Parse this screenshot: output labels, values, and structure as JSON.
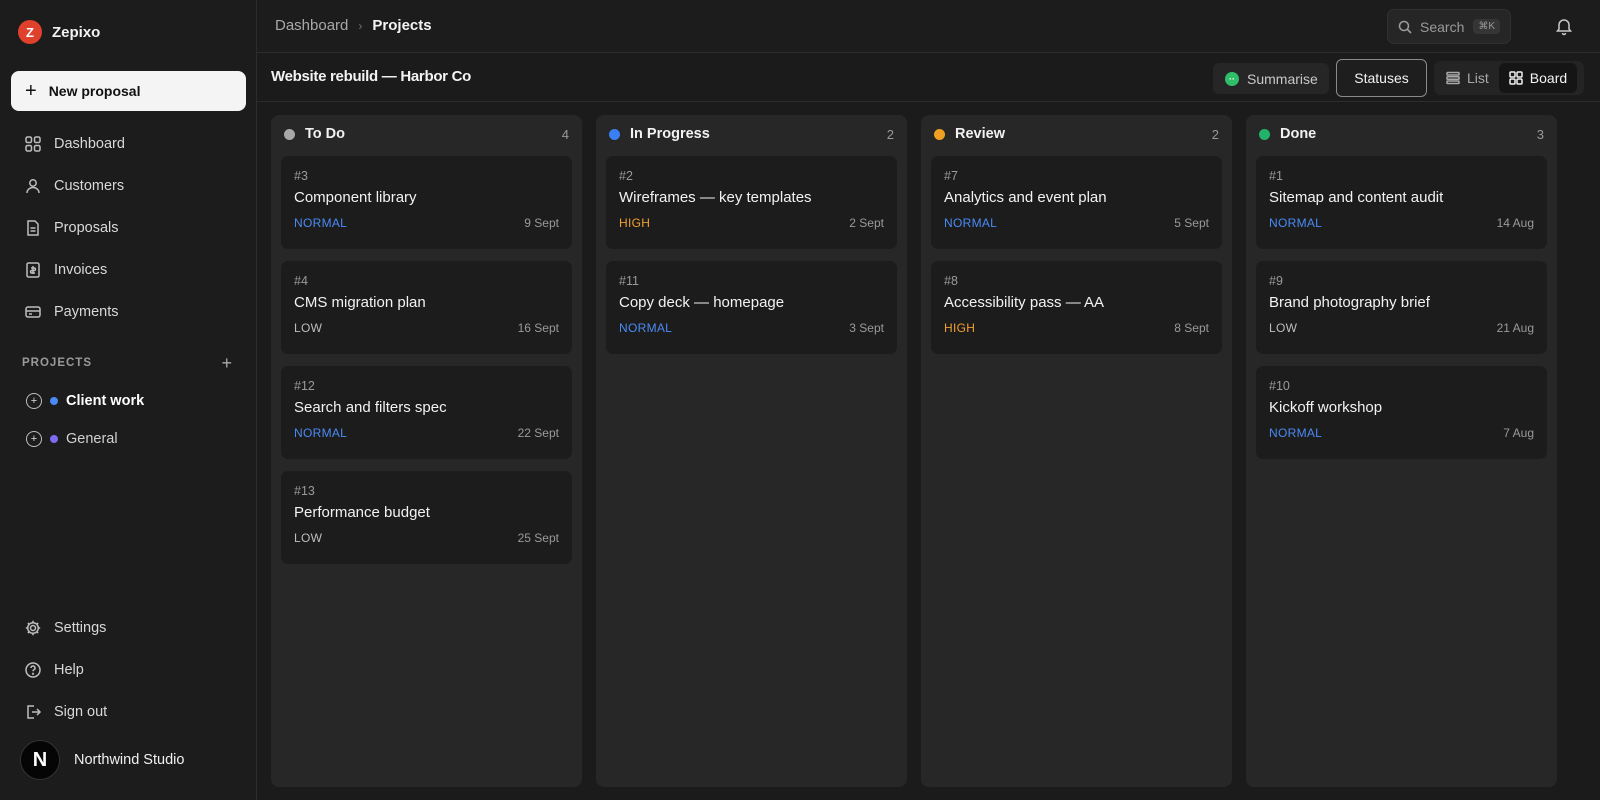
{
  "brand": {
    "name": "Zepixo",
    "logo_letter": "Z",
    "color": "#e0412c"
  },
  "sidebar": {
    "new_button": "New proposal",
    "nav": [
      {
        "label": "Dashboard",
        "icon": "grid-icon"
      },
      {
        "label": "Customers",
        "icon": "users-icon"
      },
      {
        "label": "Proposals",
        "icon": "file-icon"
      },
      {
        "label": "Invoices",
        "icon": "invoice-icon"
      },
      {
        "label": "Payments",
        "icon": "card-icon"
      }
    ],
    "projects_label": "PROJECTS",
    "projects": [
      {
        "name": "Client work",
        "color": "#4a8af4"
      },
      {
        "name": "General",
        "color": "#7b6cf0"
      }
    ],
    "bottom_nav": [
      {
        "label": "Settings",
        "icon": "gear-icon"
      },
      {
        "label": "Help",
        "icon": "help-icon"
      },
      {
        "label": "Sign out",
        "icon": "signout-icon"
      }
    ],
    "account": {
      "avatar_letter": "N",
      "name": "Northwind Studio"
    }
  },
  "topbar": {
    "breadcrumb": [
      "Dashboard",
      "Projects"
    ],
    "search_placeholder": "Search",
    "search_shortcut": "⌘K"
  },
  "subbar": {
    "title": "Website rebuild — Harbor Co",
    "summarise": "Summarise",
    "statuses": "Statuses",
    "views": [
      "List",
      "Board"
    ],
    "active_view": "Board"
  },
  "priority_colors": {
    "NORMAL": "#4a8af4",
    "HIGH": "#f0a030",
    "LOW": "#bdbdbd"
  },
  "columns": [
    {
      "title": "To Do",
      "count": "4",
      "color": "#a8a8a8",
      "cards": [
        {
          "id": "#3",
          "title": "Component library",
          "priority": "NORMAL",
          "date": "9 Sept"
        },
        {
          "id": "#4",
          "title": "CMS migration plan",
          "priority": "LOW",
          "date": "16 Sept"
        },
        {
          "id": "#12",
          "title": "Search and filters spec",
          "priority": "NORMAL",
          "date": "22 Sept"
        },
        {
          "id": "#13",
          "title": "Performance budget",
          "priority": "LOW",
          "date": "25 Sept"
        }
      ]
    },
    {
      "title": "In Progress",
      "count": "2",
      "color": "#3b7ff5",
      "cards": [
        {
          "id": "#2",
          "title": "Wireframes — key templates",
          "priority": "HIGH",
          "date": "2 Sept"
        },
        {
          "id": "#11",
          "title": "Copy deck — homepage",
          "priority": "NORMAL",
          "date": "3 Sept"
        }
      ]
    },
    {
      "title": "Review",
      "count": "2",
      "color": "#f0a020",
      "cards": [
        {
          "id": "#7",
          "title": "Analytics and event plan",
          "priority": "NORMAL",
          "date": "5 Sept"
        },
        {
          "id": "#8",
          "title": "Accessibility pass — AA",
          "priority": "HIGH",
          "date": "8 Sept"
        }
      ]
    },
    {
      "title": "Done",
      "count": "3",
      "color": "#22b36b",
      "cards": [
        {
          "id": "#1",
          "title": "Sitemap and content audit",
          "priority": "NORMAL",
          "date": "14 Aug"
        },
        {
          "id": "#9",
          "title": "Brand photography brief",
          "priority": "LOW",
          "date": "21 Aug"
        },
        {
          "id": "#10",
          "title": "Kickoff workshop",
          "priority": "NORMAL",
          "date": "7 Aug"
        }
      ]
    }
  ]
}
